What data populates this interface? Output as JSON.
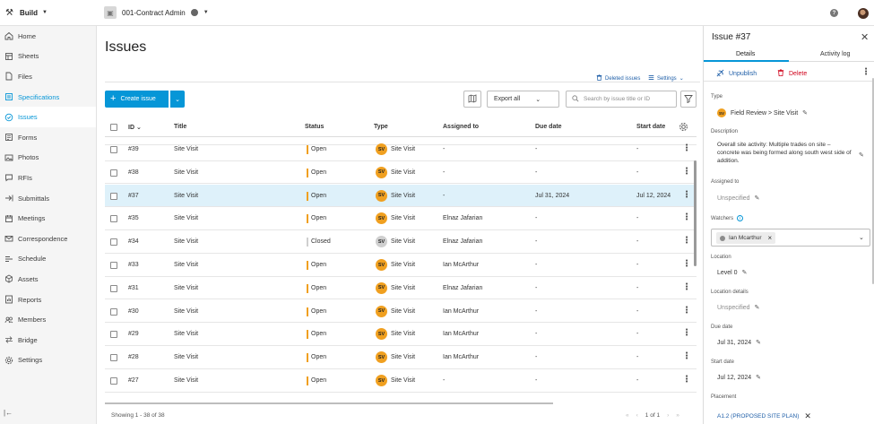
{
  "topbar": {
    "app_name": "Build",
    "project_name": "001-Contract Admin"
  },
  "sidebar": {
    "items": [
      {
        "label": "Home",
        "icon": "home-icon"
      },
      {
        "label": "Sheets",
        "icon": "sheets-icon"
      },
      {
        "label": "Files",
        "icon": "files-icon"
      },
      {
        "label": "Specifications",
        "icon": "specifications-icon"
      },
      {
        "label": "Issues",
        "icon": "issues-icon"
      },
      {
        "label": "Forms",
        "icon": "forms-icon"
      },
      {
        "label": "Photos",
        "icon": "photos-icon"
      },
      {
        "label": "RFIs",
        "icon": "rfis-icon"
      },
      {
        "label": "Submittals",
        "icon": "submittals-icon"
      },
      {
        "label": "Meetings",
        "icon": "meetings-icon"
      },
      {
        "label": "Correspondence",
        "icon": "correspondence-icon"
      },
      {
        "label": "Schedule",
        "icon": "schedule-icon"
      },
      {
        "label": "Assets",
        "icon": "assets-icon"
      },
      {
        "label": "Reports",
        "icon": "reports-icon"
      },
      {
        "label": "Members",
        "icon": "members-icon"
      },
      {
        "label": "Bridge",
        "icon": "bridge-icon"
      },
      {
        "label": "Settings",
        "icon": "settings-icon"
      }
    ],
    "collapse_glyph": "|←"
  },
  "main": {
    "title": "Issues",
    "deleted_issues": "Deleted issues",
    "settings": "Settings",
    "create_label": "Create issue",
    "export_label": "Export all",
    "search_placeholder": "Search by issue title or ID",
    "columns": {
      "id": "ID",
      "title": "Title",
      "status": "Status",
      "type": "Type",
      "assigned": "Assigned to",
      "due": "Due date",
      "start": "Start date"
    },
    "rows": [
      {
        "id": "#39",
        "title": "Site Visit",
        "status": "Open",
        "badge": "SV",
        "type": "Site Visit",
        "assigned": "-",
        "due": "-",
        "start": "-",
        "selected": false
      },
      {
        "id": "#38",
        "title": "Site Visit",
        "status": "Open",
        "badge": "SV",
        "type": "Site Visit",
        "assigned": "-",
        "due": "-",
        "start": "-",
        "selected": false
      },
      {
        "id": "#37",
        "title": "Site Visit",
        "status": "Open",
        "badge": "SV",
        "type": "Site Visit",
        "assigned": "-",
        "due": "Jul 31, 2024",
        "start": "Jul 12, 2024",
        "selected": true
      },
      {
        "id": "#35",
        "title": "Site Visit",
        "status": "Open",
        "badge": "SV",
        "type": "Site Visit",
        "assigned": "Elnaz Jafarian",
        "due": "-",
        "start": "-",
        "selected": false
      },
      {
        "id": "#34",
        "title": "Site Visit",
        "status": "Closed",
        "badge": "SV",
        "type": "Site Visit",
        "assigned": "Elnaz Jafarian",
        "due": "-",
        "start": "-",
        "selected": false
      },
      {
        "id": "#33",
        "title": "Site Visit",
        "status": "Open",
        "badge": "SV",
        "type": "Site Visit",
        "assigned": "Ian McArthur",
        "due": "-",
        "start": "-",
        "selected": false
      },
      {
        "id": "#31",
        "title": "Site Visit",
        "status": "Open",
        "badge": "SV",
        "type": "Site Visit",
        "assigned": "Elnaz Jafarian",
        "due": "-",
        "start": "-",
        "selected": false
      },
      {
        "id": "#30",
        "title": "Site Visit",
        "status": "Open",
        "badge": "SV",
        "type": "Site Visit",
        "assigned": "Ian McArthur",
        "due": "-",
        "start": "-",
        "selected": false
      },
      {
        "id": "#29",
        "title": "Site Visit",
        "status": "Open",
        "badge": "SV",
        "type": "Site Visit",
        "assigned": "Ian McArthur",
        "due": "-",
        "start": "-",
        "selected": false
      },
      {
        "id": "#28",
        "title": "Site Visit",
        "status": "Open",
        "badge": "SV",
        "type": "Site Visit",
        "assigned": "Ian McArthur",
        "due": "-",
        "start": "-",
        "selected": false
      },
      {
        "id": "#27",
        "title": "Site Visit",
        "status": "Open",
        "badge": "SV",
        "type": "Site Visit",
        "assigned": "-",
        "due": "-",
        "start": "-",
        "selected": false
      }
    ],
    "footer_count": "Showing 1 - 38 of 38",
    "pager": "1 of 1"
  },
  "panel": {
    "title": "Issue #37",
    "tab_details": "Details",
    "tab_activity": "Activity log",
    "unpublish": "Unpublish",
    "delete": "Delete",
    "type_label": "Type",
    "type_badge": "SV",
    "type_value": "Field Review > Site Visit",
    "description_label": "Description",
    "description_value": "Overall site activity:  Multiple trades on site – concrete was being formed along south west side of addition.",
    "assigned_label": "Assigned to",
    "assigned_value": "Unspecified",
    "watchers_label": "Watchers",
    "watcher": "Ian Mcarthur",
    "location_label": "Location",
    "location_value": "Level 0",
    "location_details_label": "Location details",
    "location_details_value": "Unspecified",
    "due_label": "Due date",
    "due_value": "Jul 31, 2024",
    "start_label": "Start date",
    "start_value": "Jul 12, 2024",
    "placement_label": "Placement",
    "placement_value": "A1.2 (PROPOSED SITE PLAN)"
  },
  "colors": {
    "accent": "#0696d7",
    "link": "#1f5fa8",
    "open_status": "#f0a020",
    "closed_status": "#cfcfcf",
    "selected_row": "#def1fa",
    "delete": "#d0021b"
  }
}
